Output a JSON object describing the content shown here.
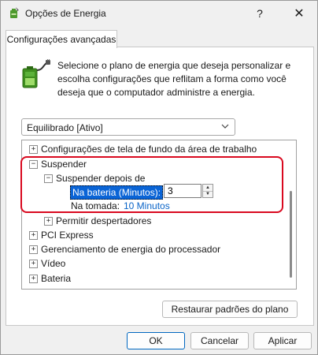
{
  "window": {
    "title": "Opções de Energia",
    "help_glyph": "?",
    "close_glyph": "✕"
  },
  "tab": {
    "label": "Configurações avançadas"
  },
  "description": "Selecione o plano de energia que deseja personalizar e escolha configurações que reflitam a forma como você deseja que o computador administre a energia.",
  "plan": {
    "selected": "Equilibrado [Ativo]"
  },
  "tree": {
    "items": [
      {
        "label": "Configurações de tela de fundo da área de trabalho",
        "toggle": "+"
      },
      {
        "label": "Suspender",
        "toggle": "−"
      },
      {
        "label": "Suspender depois de",
        "toggle": "−"
      },
      {
        "label": "Permitir despertadores",
        "toggle": "+"
      },
      {
        "label": "PCI Express",
        "toggle": "+"
      },
      {
        "label": "Gerenciamento de energia do processador",
        "toggle": "+"
      },
      {
        "label": "Vídeo",
        "toggle": "+"
      },
      {
        "label": "Bateria",
        "toggle": "+"
      }
    ],
    "on_battery": {
      "label": "Na bateria (Minutos):",
      "value": "3"
    },
    "plugged_in": {
      "label": "Na tomada:",
      "value": "10 Minutos"
    }
  },
  "buttons": {
    "restore": "Restaurar padrões do plano",
    "ok": "OK",
    "cancel": "Cancelar",
    "apply": "Aplicar"
  },
  "icons": {
    "app": "power-options-icon",
    "battery": "battery-plug-icon",
    "highlight_color": "#d9091f",
    "link_color": "#0a64c8",
    "selection_color": "#0a64d6"
  }
}
